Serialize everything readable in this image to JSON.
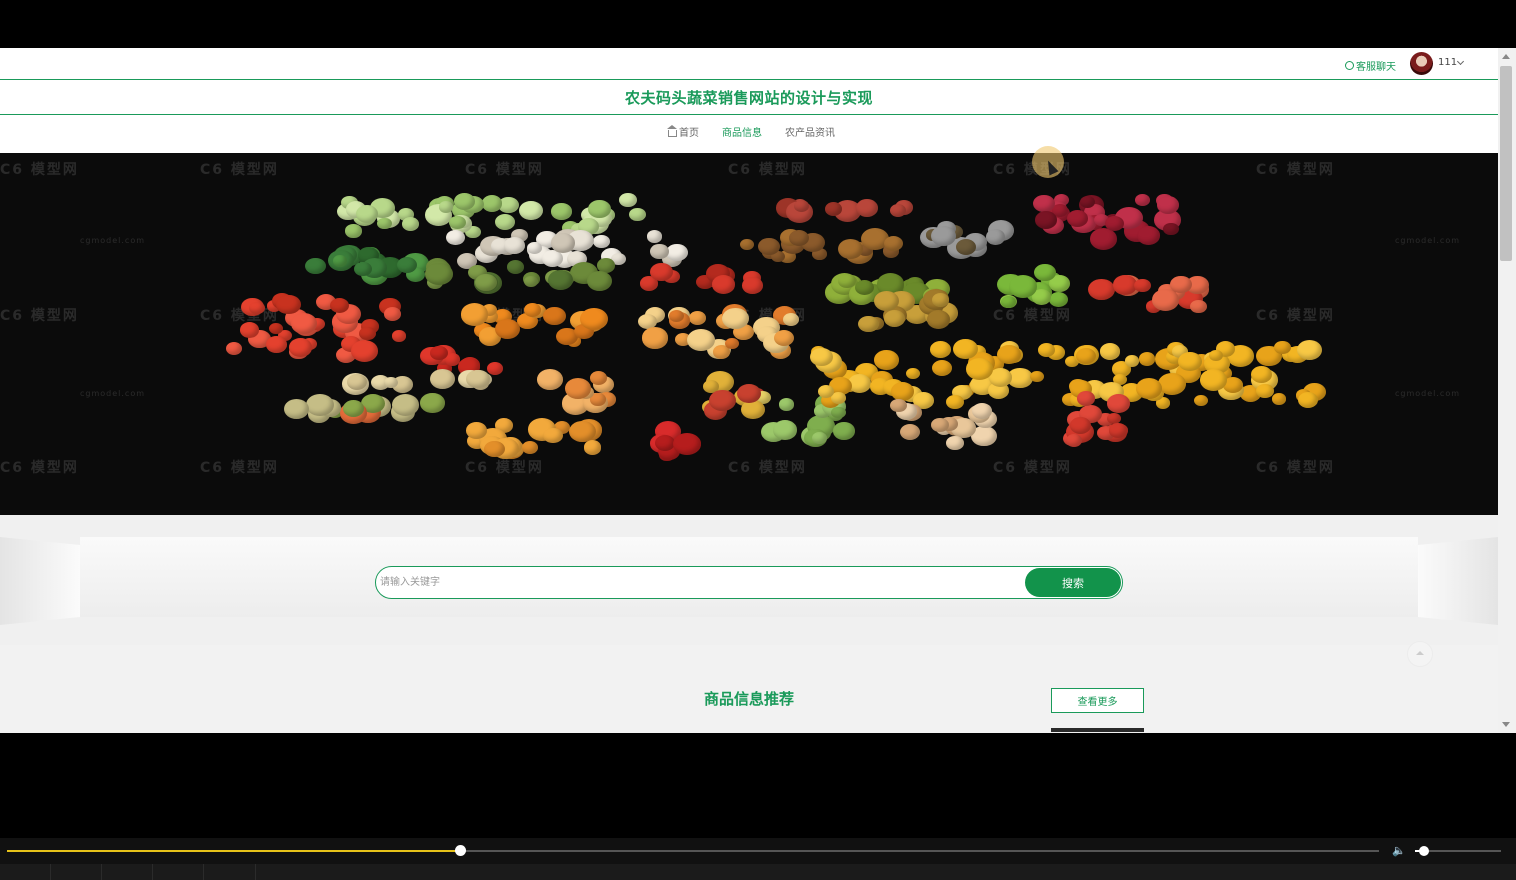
{
  "header": {
    "chat_label": "客服聊天",
    "username": "111"
  },
  "site": {
    "title": "农夫码头蔬菜销售网站的设计与实现"
  },
  "nav": {
    "items": [
      {
        "label": "首页",
        "active": false,
        "icon": "home-icon"
      },
      {
        "label": "商品信息",
        "active": true
      },
      {
        "label": "农产品资讯",
        "active": false
      }
    ]
  },
  "banner": {
    "watermark": "模型网",
    "watermark_url": "cgmodel.com"
  },
  "search": {
    "placeholder": "请输入关键字",
    "button_label": "搜索"
  },
  "recommend": {
    "title": "商品信息推荐",
    "more_label": "查看更多"
  },
  "player": {
    "progress": 0.33,
    "volume": 0.1
  },
  "colors": {
    "accent": "#1a9a5a",
    "button": "#12934b",
    "progress": "#e6c21a"
  }
}
